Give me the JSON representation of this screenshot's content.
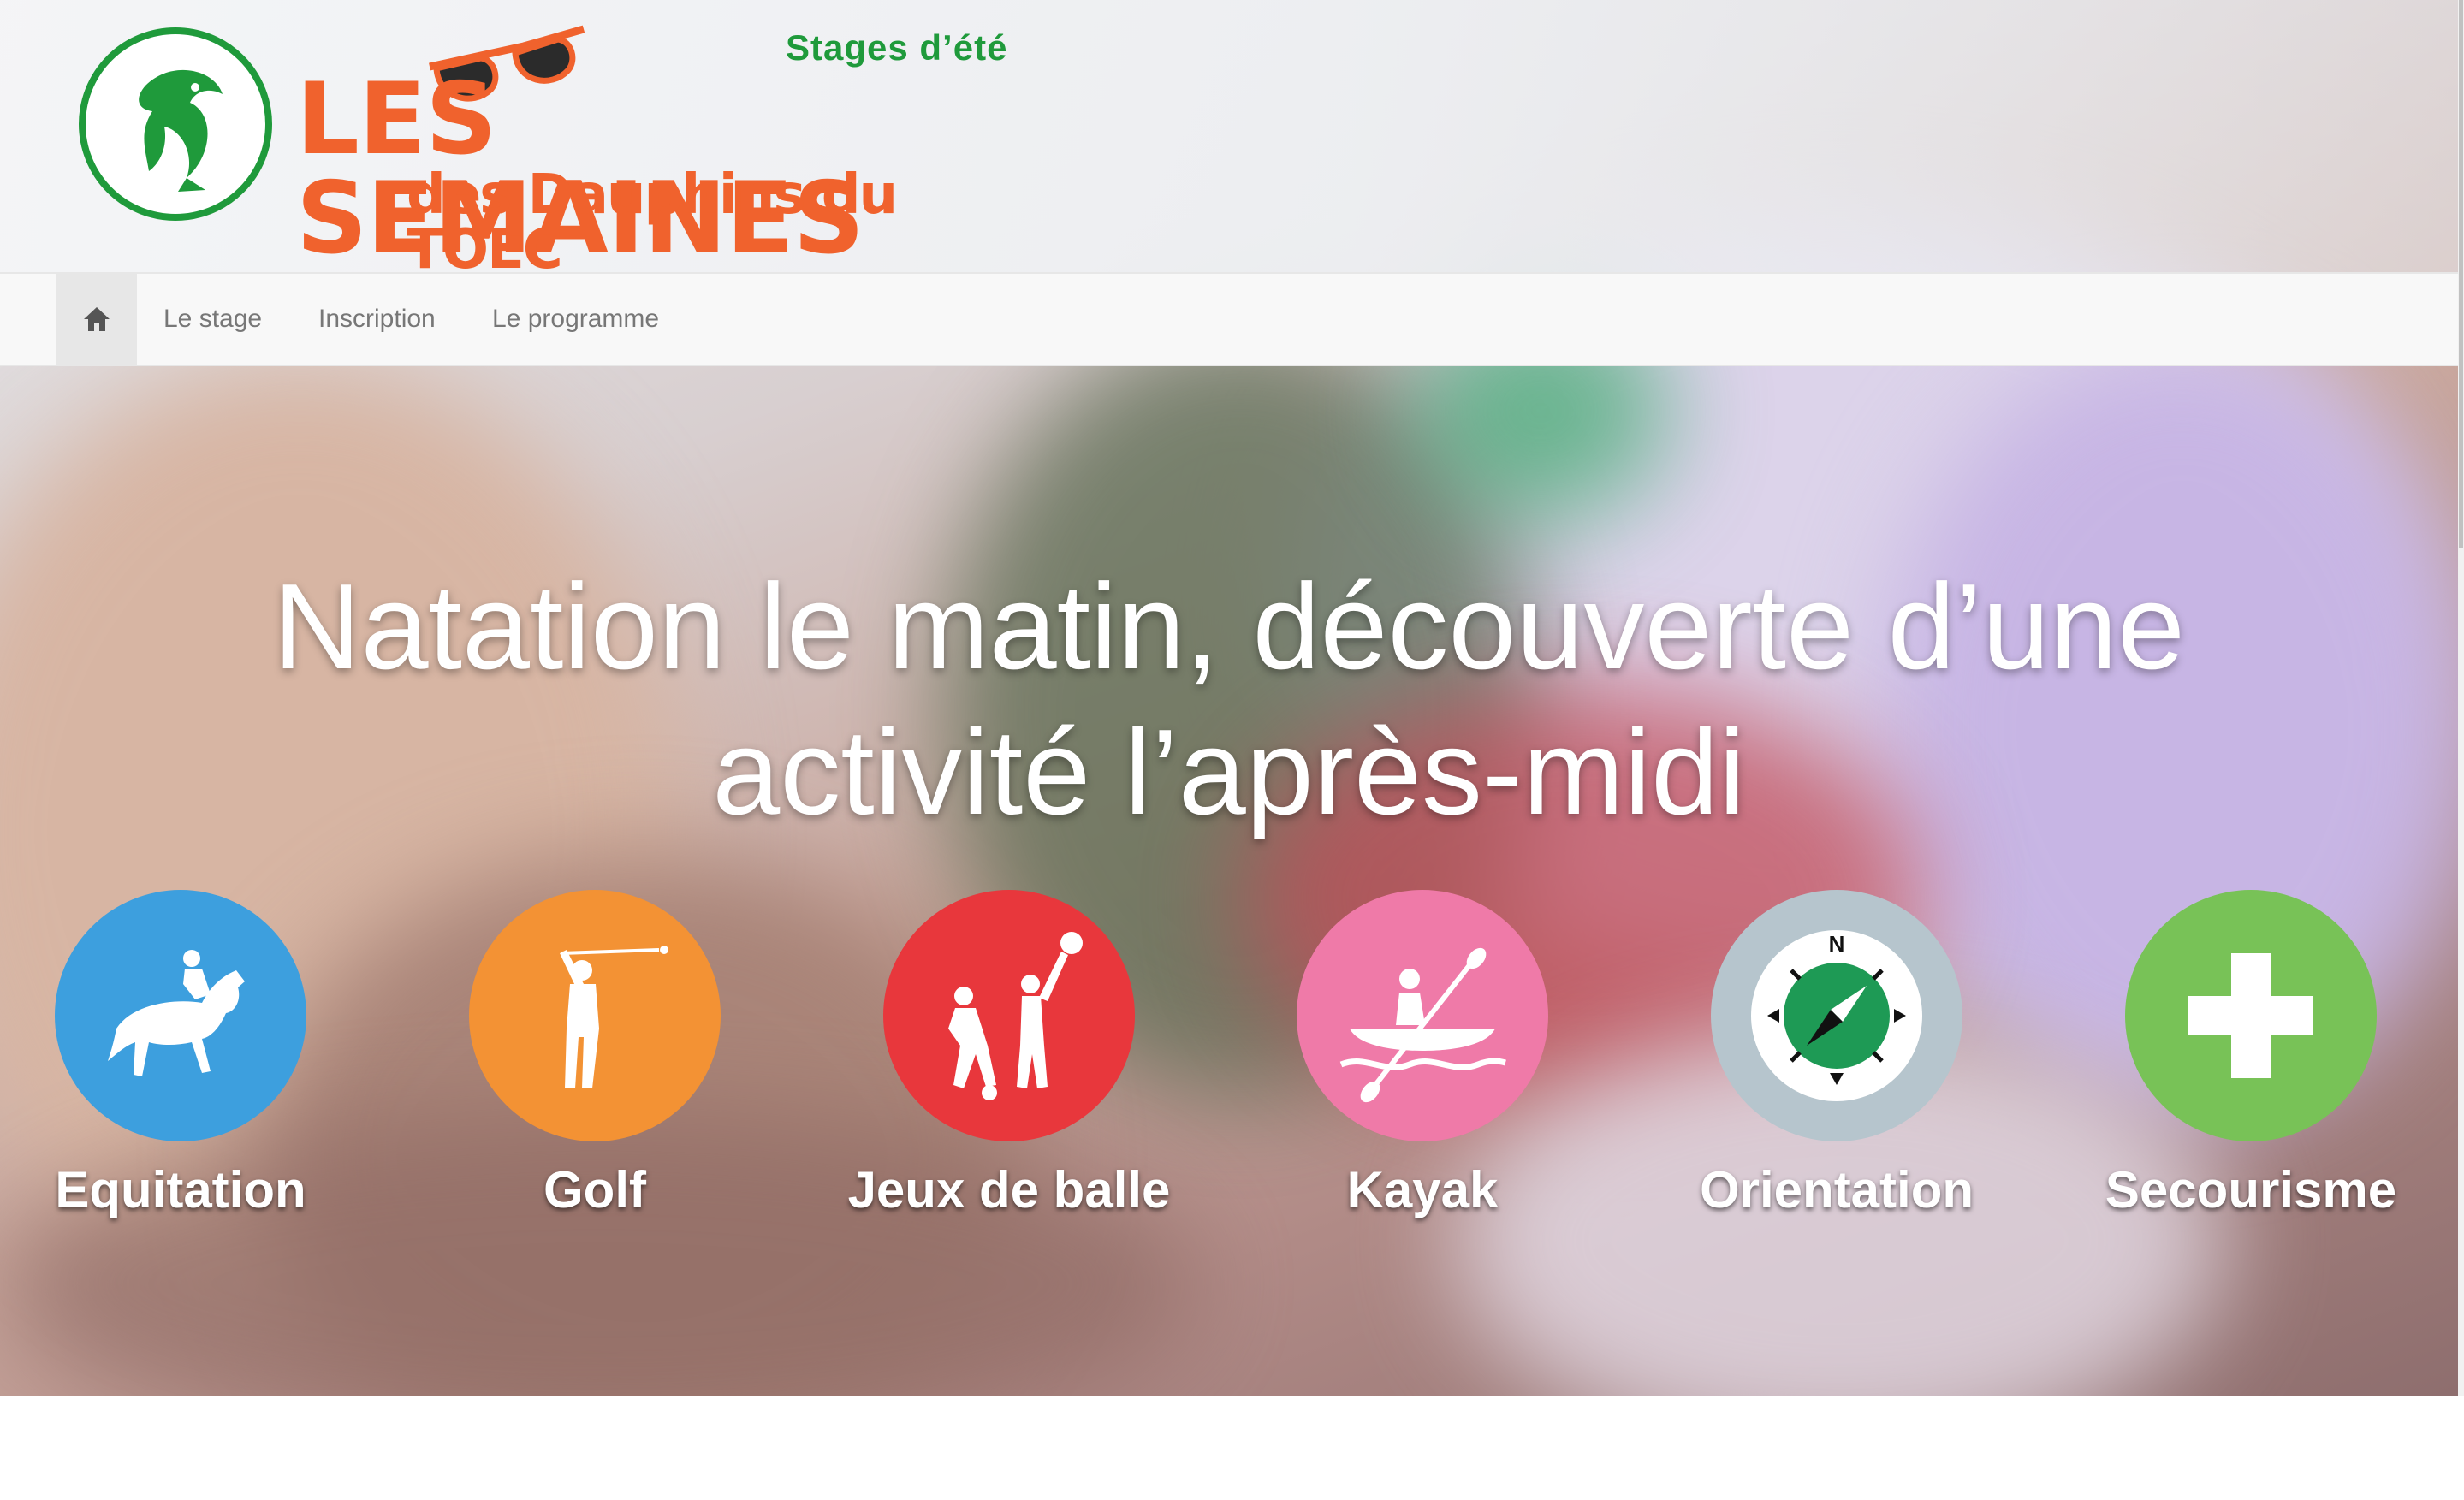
{
  "logo": {
    "tagline": "Stages d’été",
    "brand_main": "LES SEMAINES",
    "brand_sub": "des Dauphins du TOEC"
  },
  "nav": {
    "home_icon": "home-icon",
    "items": [
      {
        "label": "Le stage"
      },
      {
        "label": "Inscription"
      },
      {
        "label": "Le programme"
      }
    ]
  },
  "hero": {
    "line1": "Natation le matin, découverte d’une",
    "line2": "activité l’après-midi"
  },
  "activities": [
    {
      "label": "Equitation",
      "icon": "horse-rider-icon",
      "color": "#3d9fde"
    },
    {
      "label": "Golf",
      "icon": "golfer-icon",
      "color": "#f39234"
    },
    {
      "label": "Jeux de balle",
      "icon": "ball-games-icon",
      "color": "#e8373c"
    },
    {
      "label": "Kayak",
      "icon": "kayak-icon",
      "color": "#ef7aa8"
    },
    {
      "label": "Orientation",
      "icon": "compass-icon",
      "color": "#b6c5cd"
    },
    {
      "label": "Secourisme",
      "icon": "first-aid-cross-icon",
      "color": "#78c257"
    }
  ],
  "colors": {
    "brand_orange": "#f0622d",
    "brand_green": "#1f9a3b"
  }
}
